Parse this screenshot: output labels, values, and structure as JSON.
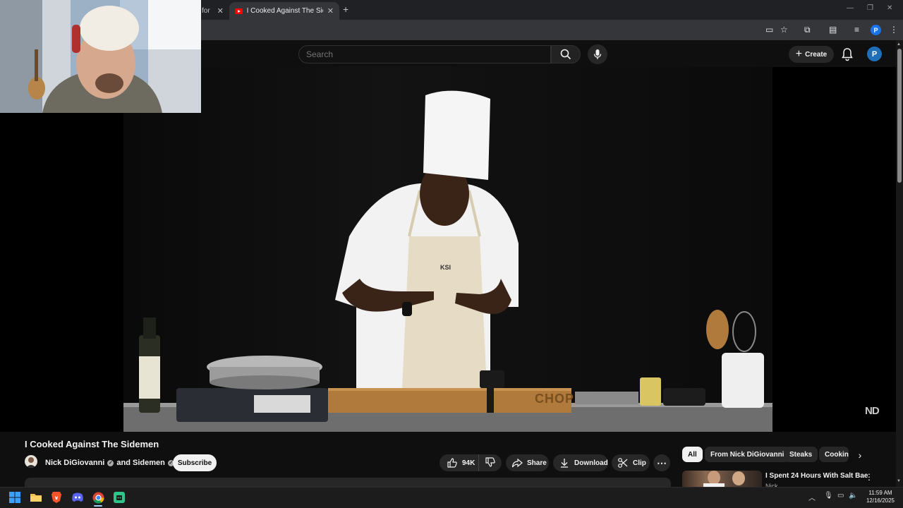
{
  "browser": {
    "tabs": [
      {
        "label": "for",
        "active": false
      },
      {
        "label": "I Cooked Against The Sidemen",
        "active": true
      }
    ],
    "new_tab": "+",
    "profile_initial": "P"
  },
  "youtube": {
    "search": {
      "placeholder": "Search"
    },
    "create_label": "Create",
    "avatar_initial": "P"
  },
  "video": {
    "watermark": "ND",
    "title": "I Cooked Against The Sidemen",
    "channel": "Nick DiGiovanni",
    "collaborator_prefix": "and",
    "collaborator": "Sidemen",
    "subscribe_label": "Subscribe",
    "likes": "94K",
    "share_label": "Share",
    "download_label": "Download",
    "clip_label": "Clip",
    "scene_text": {
      "apron_logo": "KSI",
      "board_text": "CHOP"
    }
  },
  "sidebar": {
    "chips": [
      "All",
      "From Nick DiGiovanni",
      "Steaks",
      "Cooking"
    ],
    "recommendation": {
      "title": "I Spent 24 Hours With Salt Bae",
      "channel": "Nick"
    }
  },
  "taskbar": {
    "time": "11:59 AM",
    "date": "12/16/2025"
  },
  "colors": {
    "youtube_red": "#ff0000",
    "background": "#0f0f0f",
    "pill": "#272727",
    "avatar_blue": "#1e6fb8"
  },
  "icons": [
    "windows-start-icon",
    "file-explorer-icon",
    "brave-icon",
    "discord-icon",
    "chrome-icon",
    "app-icon",
    "search-icon",
    "mic-icon",
    "bell-icon",
    "like-icon",
    "dislike-icon",
    "share-icon",
    "download-icon",
    "clip-icon",
    "more-icon"
  ]
}
